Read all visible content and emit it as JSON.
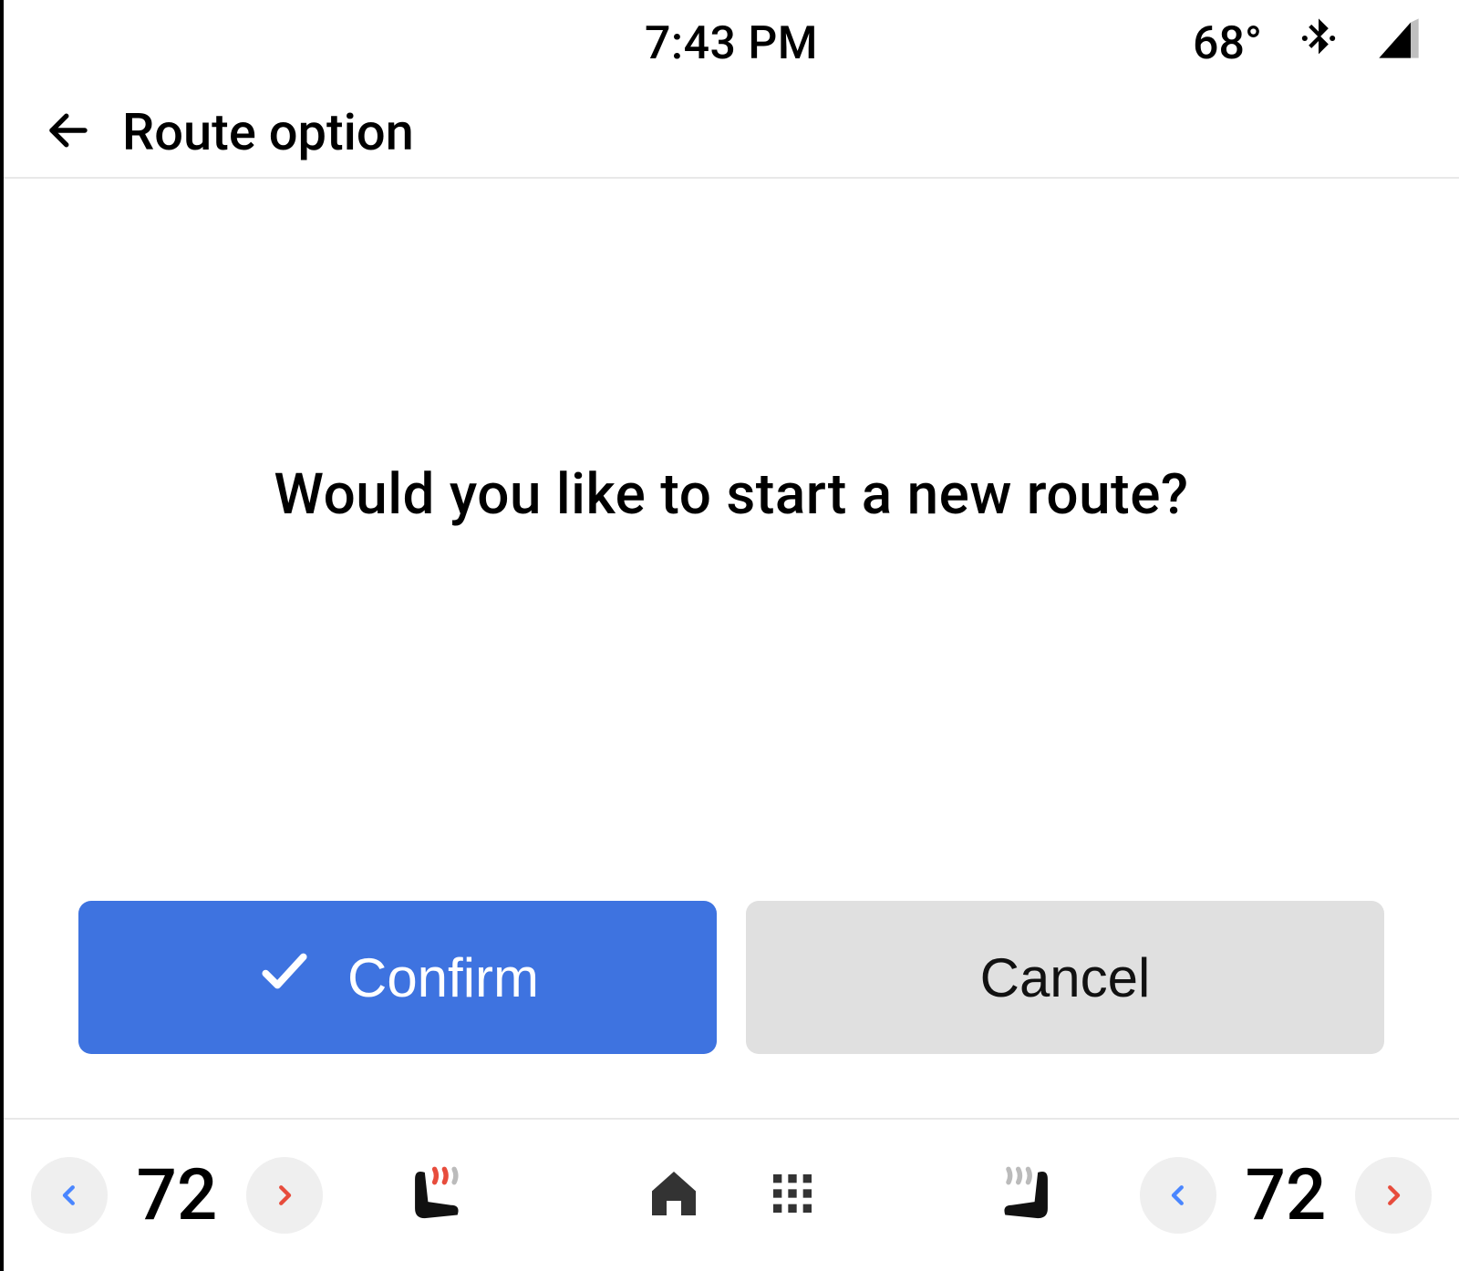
{
  "status": {
    "time": "7:43 PM",
    "outside_temp": "68°"
  },
  "header": {
    "title": "Route option"
  },
  "main": {
    "prompt": "Would you like to start a new route?",
    "confirm_label": "Confirm",
    "cancel_label": "Cancel"
  },
  "climate": {
    "left_temp": "72",
    "right_temp": "72"
  },
  "colors": {
    "primary": "#3e73e0",
    "cool": "#4a86ff",
    "warm": "#e74c3c"
  }
}
